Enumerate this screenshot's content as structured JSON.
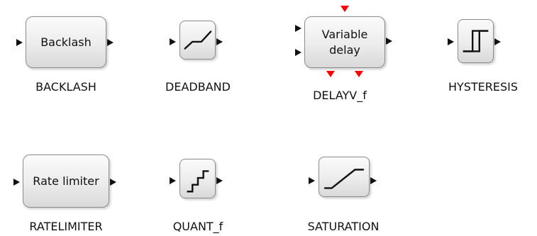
{
  "blocks": {
    "backlash": {
      "text": "Backlash",
      "label": "BACKLASH"
    },
    "deadband": {
      "icon": "deadband-icon",
      "label": "DEADBAND"
    },
    "delayv": {
      "text": "Variable\ndelay",
      "label": "DELAYV_f"
    },
    "hysteresis": {
      "icon": "hysteresis-icon",
      "label": "HYSTERESIS"
    },
    "ratelimiter": {
      "text": "Rate limiter",
      "label": "RATELIMITER"
    },
    "quant": {
      "icon": "staircase-icon",
      "label": "QUANT_f"
    },
    "saturation": {
      "icon": "saturation-icon",
      "label": "SATURATION"
    }
  },
  "colors": {
    "regular_port": "#111111",
    "event_port": "#ff0000",
    "block_border": "#8c8c8c",
    "block_fill": "#ececec"
  }
}
